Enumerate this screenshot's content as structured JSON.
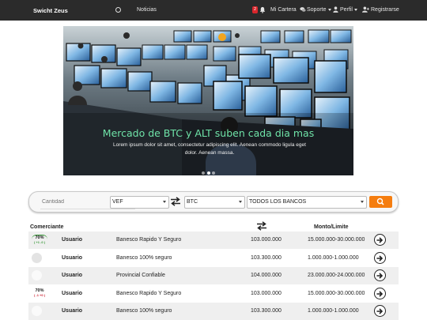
{
  "navbar": {
    "brand": "Swicht Zeus",
    "noticias": "Noticias",
    "notif_count": "2",
    "wallet": "Mi Cartera",
    "support": "Soporte",
    "profile": "Perfil",
    "register": "Registrarse"
  },
  "carousel": {
    "title": "Mercado de BTC y ALT suben cada dia mas",
    "text": "Lorem ipsum dolor sit amet, consectetur adipiscing elit. Aenean commodo ligula eget dolor. Aenean massa.",
    "slides": 3,
    "active_slide": 1
  },
  "search": {
    "amount_placeholder": "Cantidad",
    "from_currency": "VEF",
    "to_currency": "BTC",
    "bank": "TODOS LOS BANCOS",
    "button_color": "#f57d0f"
  },
  "table": {
    "headers": {
      "merchant": "Comerciante",
      "limit": "Monto/Limite"
    },
    "rows": [
      {
        "rating": "70%",
        "rating_sub": "( +1 -0 )",
        "user": "Usuario",
        "bank": "Banesco Rapido Y Seguro",
        "price": "103.000.000",
        "limit": "15.000.000-30.000.000"
      },
      {
        "rating": "",
        "rating_sub": "",
        "user": "Usuario",
        "bank": "Banesco 100% seguro",
        "price": "103.300.000",
        "limit": "1.000.000-1.000.000"
      },
      {
        "rating": "",
        "rating_sub": "",
        "user": "Usuario",
        "bank": "Provincial Confiable",
        "price": "104.000.000",
        "limit": "23.000.000-24.000.000"
      },
      {
        "rating": "70%",
        "rating_sub": "( -1 +0 )",
        "user": "Usuario",
        "bank": "Banesco Rapido Y Seguro",
        "price": "103.000.000",
        "limit": "15.000.000-30.000.000"
      },
      {
        "rating": "",
        "rating_sub": "",
        "user": "Usuario",
        "bank": "Banesco 100% seguro",
        "price": "103.300.000",
        "limit": "1.000.000-1.000.000"
      }
    ]
  }
}
